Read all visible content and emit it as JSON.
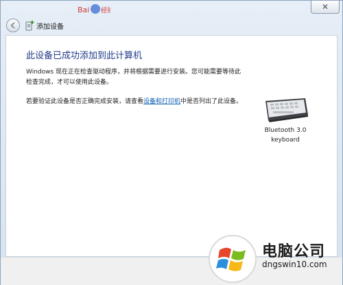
{
  "window": {
    "close_symbol": "✕"
  },
  "nav": {
    "back_icon": "back-arrow-icon",
    "title": "添加设备"
  },
  "main": {
    "heading": "此设备已成功添加到此计算机",
    "paragraph1": "Windows 现在正在检查驱动程序，并将根据需要进行安装。您可能需要等待此检查完成，才可以使用此设备。",
    "paragraph2_before": "若要验证此设备是否正确完成安装，请查看",
    "paragraph2_link": "设备和打印机",
    "paragraph2_after": "中是否列出了此设备。"
  },
  "device": {
    "label_line1": "Bluetooth 3.0",
    "label_line2": "keyboard"
  },
  "watermark": {
    "brand": "电脑公司",
    "site": "dngswin10.com"
  },
  "colors": {
    "heading": "#1f3a8a",
    "link": "#0b5fb3"
  }
}
